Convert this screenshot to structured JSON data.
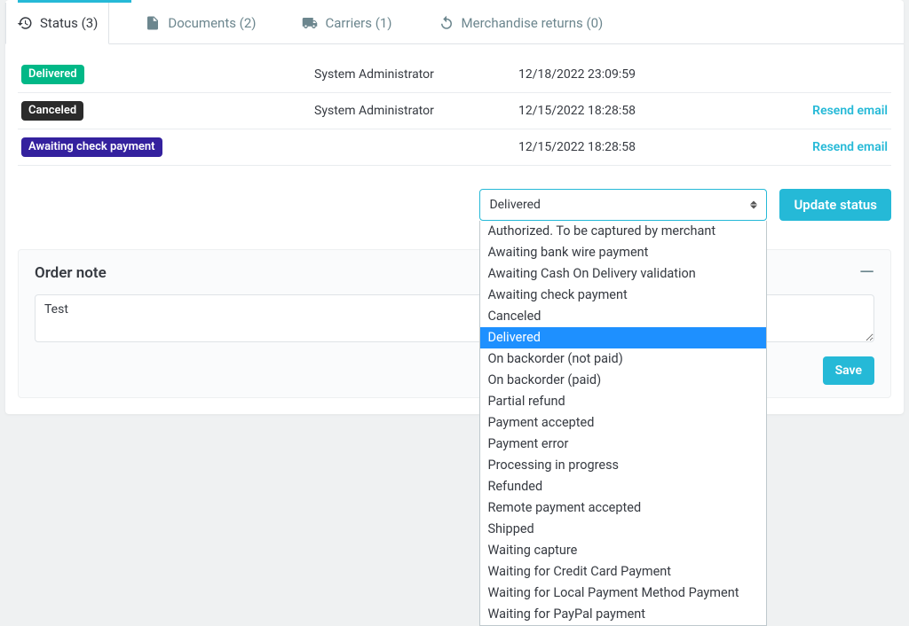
{
  "colors": {
    "accent": "#25b9d7",
    "badge_delivered": "#01b887",
    "badge_canceled": "#2b2b2b",
    "badge_awaiting": "#34219e"
  },
  "tabs": {
    "status": "Status (3)",
    "documents": "Documents (2)",
    "carriers": "Carriers (1)",
    "returns": "Merchandise returns (0)"
  },
  "history": [
    {
      "status": "Delivered",
      "badgeColor": "#01b887",
      "employee": "System Administrator",
      "date": "12/18/2022 23:09:59",
      "resend": ""
    },
    {
      "status": "Canceled",
      "badgeColor": "#2b2b2b",
      "employee": "System Administrator",
      "date": "12/15/2022 18:28:58",
      "resend": "Resend email"
    },
    {
      "status": "Awaiting check payment",
      "badgeColor": "#34219e",
      "employee": "",
      "date": "12/15/2022 18:28:58",
      "resend": "Resend email"
    }
  ],
  "statusSelect": {
    "selected": "Delivered",
    "options": [
      "Authorized. To be captured by merchant",
      "Awaiting bank wire payment",
      "Awaiting Cash On Delivery validation",
      "Awaiting check payment",
      "Canceled",
      "Delivered",
      "On backorder (not paid)",
      "On backorder (paid)",
      "Partial refund",
      "Payment accepted",
      "Payment error",
      "Processing in progress",
      "Refunded",
      "Remote payment accepted",
      "Shipped",
      "Waiting capture",
      "Waiting for Credit Card Payment",
      "Waiting for Local Payment Method Payment",
      "Waiting for PayPal payment"
    ]
  },
  "buttons": {
    "updateStatus": "Update status",
    "save": "Save"
  },
  "orderNote": {
    "title": "Order note",
    "value": "Test"
  }
}
